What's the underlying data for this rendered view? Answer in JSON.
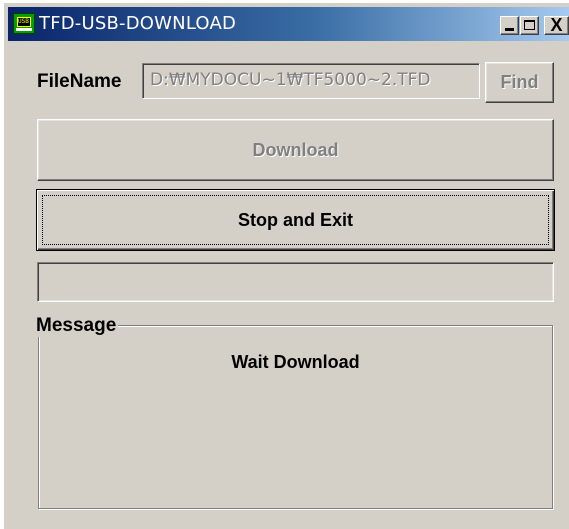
{
  "window": {
    "title": "TFD-USB-DOWNLOAD",
    "icon": "usb-device-app-icon",
    "icon_text": "USB",
    "titlebar_colors": [
      "#0a246a",
      "#a6caf0"
    ],
    "controls": {
      "minimize_icon": "minimize-icon",
      "maximize_icon": "maximize-icon",
      "close_icon": "close-icon",
      "close_glyph": "X"
    }
  },
  "filename": {
    "label": "FileName",
    "value": "D:\\MYDOCU~1\\TF5000~2.TFD",
    "display_value": "D:₩MYDOCU~1₩TF5000~2.TFD",
    "enabled": false,
    "find_label": "Find",
    "find_enabled": false
  },
  "actions": {
    "download_label": "Download",
    "download_enabled": false,
    "stop_label": "Stop and Exit",
    "stop_focused": true
  },
  "progress": {
    "value": 0
  },
  "message": {
    "group_label": "Message",
    "text": "Wait Download"
  },
  "colors": {
    "face": "#d4d0c8",
    "disabled_text": "#808080"
  }
}
